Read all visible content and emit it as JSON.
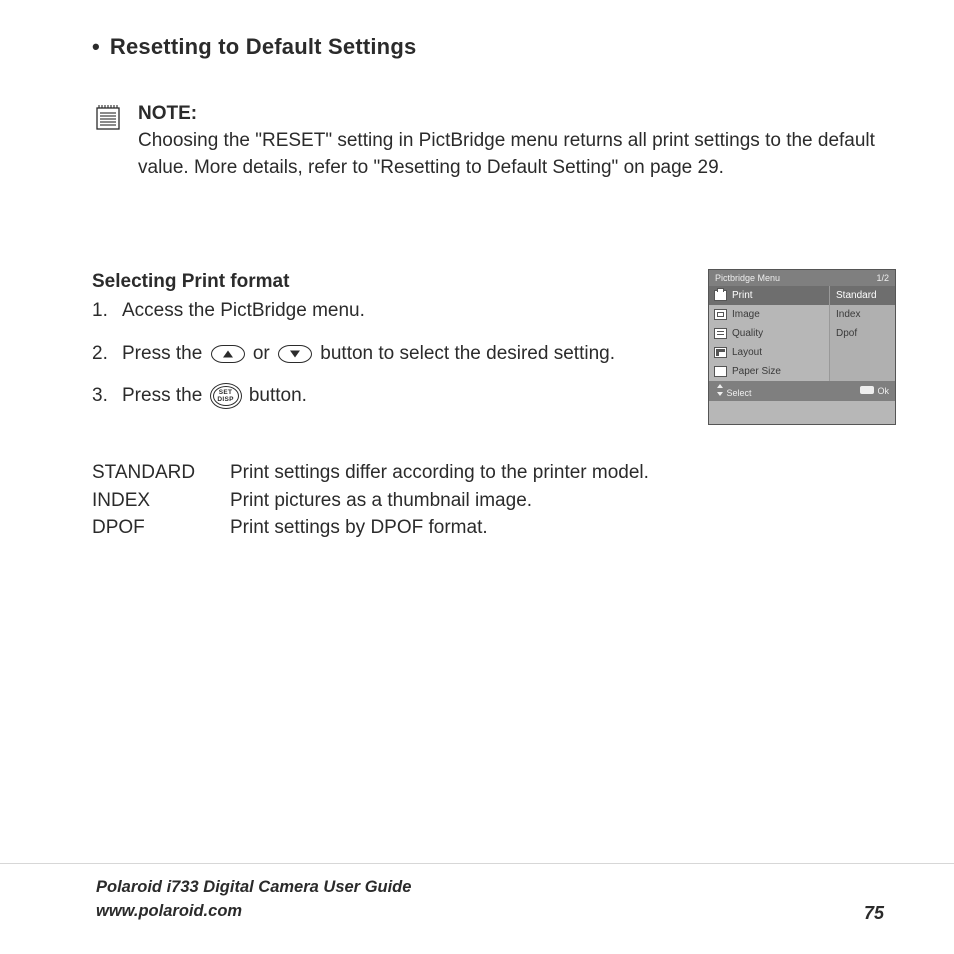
{
  "section_title": "Resetting to Default Settings",
  "note": {
    "label": "NOTE:",
    "body": "Choosing the \"RESET\" setting in PictBridge menu returns all print settings to the default value. More details, refer to \"Resetting to Default Setting\" on page 29."
  },
  "sub_section": "Selecting Print format",
  "steps": {
    "s1_num": "1.",
    "s1_txt": "Access the PictBridge menu.",
    "s2_num": "2.",
    "s2_a": "Press the ",
    "s2_mid": " or ",
    "s2_b": " button to select the desired setting.",
    "s3_num": "3.",
    "s3_a": "Press the ",
    "s3_b": " button."
  },
  "set_disp": {
    "top": "SET",
    "bot": "DISP"
  },
  "menu": {
    "title": "Pictbridge Menu",
    "page": "1/2",
    "left": [
      "Print",
      "Image",
      "Quality",
      "Layout",
      "Paper Size"
    ],
    "right": [
      "Standard",
      "Index",
      "Dpof"
    ],
    "footer_left": "Select",
    "footer_right": "Ok"
  },
  "definitions": [
    {
      "term": "STANDARD",
      "desc": "Print settings differ according to the printer model."
    },
    {
      "term": "INDEX",
      "desc": "Print pictures as a thumbnail image."
    },
    {
      "term": "DPOF",
      "desc": "Print settings by DPOF format."
    }
  ],
  "footer": {
    "guide": "Polaroid i733 Digital Camera User Guide",
    "url": "www.polaroid.com",
    "page": "75"
  }
}
